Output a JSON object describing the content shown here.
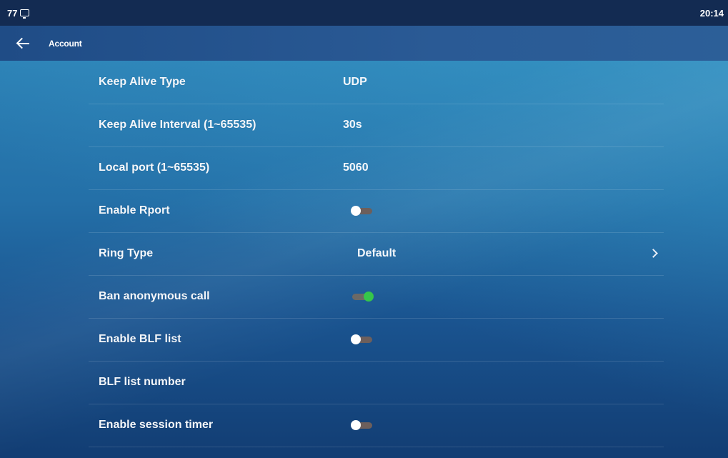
{
  "status_bar": {
    "left_text": "77",
    "time": "20:14"
  },
  "header": {
    "title": "Account"
  },
  "settings": [
    {
      "label": "Keep Alive Type",
      "value": "UDP"
    },
    {
      "label": "Keep Alive Interval (1~65535)",
      "value": "30s"
    },
    {
      "label": "Local port (1~65535)",
      "value": "5060"
    },
    {
      "label": "Enable Rport",
      "toggle": false
    },
    {
      "label": "Ring Type",
      "value": "Default"
    },
    {
      "label": "Ban anonymous call",
      "toggle": true
    },
    {
      "label": "Enable BLF list",
      "toggle": false
    },
    {
      "label": "BLF list number",
      "value": ""
    },
    {
      "label": "Enable session timer",
      "toggle": false
    }
  ],
  "colors": {
    "toggle_on": "#36c64a",
    "toggle_off_track": "#6d5f5c",
    "header_bg": "#2a5a95",
    "status_bg": "#132b52"
  },
  "icons": {
    "back": "arrow-left-icon",
    "status": "screen-icon",
    "ring_type_more": "chevron-right-icon"
  }
}
